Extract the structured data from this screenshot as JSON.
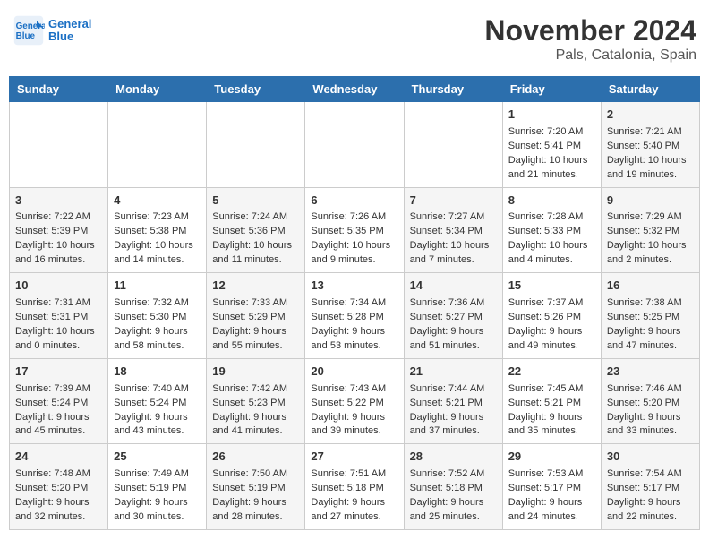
{
  "header": {
    "logo_line1": "General",
    "logo_line2": "Blue",
    "month": "November 2024",
    "location": "Pals, Catalonia, Spain"
  },
  "days_of_week": [
    "Sunday",
    "Monday",
    "Tuesday",
    "Wednesday",
    "Thursday",
    "Friday",
    "Saturday"
  ],
  "weeks": [
    [
      {
        "day": "",
        "info": ""
      },
      {
        "day": "",
        "info": ""
      },
      {
        "day": "",
        "info": ""
      },
      {
        "day": "",
        "info": ""
      },
      {
        "day": "",
        "info": ""
      },
      {
        "day": "1",
        "info": "Sunrise: 7:20 AM\nSunset: 5:41 PM\nDaylight: 10 hours and 21 minutes."
      },
      {
        "day": "2",
        "info": "Sunrise: 7:21 AM\nSunset: 5:40 PM\nDaylight: 10 hours and 19 minutes."
      }
    ],
    [
      {
        "day": "3",
        "info": "Sunrise: 7:22 AM\nSunset: 5:39 PM\nDaylight: 10 hours and 16 minutes."
      },
      {
        "day": "4",
        "info": "Sunrise: 7:23 AM\nSunset: 5:38 PM\nDaylight: 10 hours and 14 minutes."
      },
      {
        "day": "5",
        "info": "Sunrise: 7:24 AM\nSunset: 5:36 PM\nDaylight: 10 hours and 11 minutes."
      },
      {
        "day": "6",
        "info": "Sunrise: 7:26 AM\nSunset: 5:35 PM\nDaylight: 10 hours and 9 minutes."
      },
      {
        "day": "7",
        "info": "Sunrise: 7:27 AM\nSunset: 5:34 PM\nDaylight: 10 hours and 7 minutes."
      },
      {
        "day": "8",
        "info": "Sunrise: 7:28 AM\nSunset: 5:33 PM\nDaylight: 10 hours and 4 minutes."
      },
      {
        "day": "9",
        "info": "Sunrise: 7:29 AM\nSunset: 5:32 PM\nDaylight: 10 hours and 2 minutes."
      }
    ],
    [
      {
        "day": "10",
        "info": "Sunrise: 7:31 AM\nSunset: 5:31 PM\nDaylight: 10 hours and 0 minutes."
      },
      {
        "day": "11",
        "info": "Sunrise: 7:32 AM\nSunset: 5:30 PM\nDaylight: 9 hours and 58 minutes."
      },
      {
        "day": "12",
        "info": "Sunrise: 7:33 AM\nSunset: 5:29 PM\nDaylight: 9 hours and 55 minutes."
      },
      {
        "day": "13",
        "info": "Sunrise: 7:34 AM\nSunset: 5:28 PM\nDaylight: 9 hours and 53 minutes."
      },
      {
        "day": "14",
        "info": "Sunrise: 7:36 AM\nSunset: 5:27 PM\nDaylight: 9 hours and 51 minutes."
      },
      {
        "day": "15",
        "info": "Sunrise: 7:37 AM\nSunset: 5:26 PM\nDaylight: 9 hours and 49 minutes."
      },
      {
        "day": "16",
        "info": "Sunrise: 7:38 AM\nSunset: 5:25 PM\nDaylight: 9 hours and 47 minutes."
      }
    ],
    [
      {
        "day": "17",
        "info": "Sunrise: 7:39 AM\nSunset: 5:24 PM\nDaylight: 9 hours and 45 minutes."
      },
      {
        "day": "18",
        "info": "Sunrise: 7:40 AM\nSunset: 5:24 PM\nDaylight: 9 hours and 43 minutes."
      },
      {
        "day": "19",
        "info": "Sunrise: 7:42 AM\nSunset: 5:23 PM\nDaylight: 9 hours and 41 minutes."
      },
      {
        "day": "20",
        "info": "Sunrise: 7:43 AM\nSunset: 5:22 PM\nDaylight: 9 hours and 39 minutes."
      },
      {
        "day": "21",
        "info": "Sunrise: 7:44 AM\nSunset: 5:21 PM\nDaylight: 9 hours and 37 minutes."
      },
      {
        "day": "22",
        "info": "Sunrise: 7:45 AM\nSunset: 5:21 PM\nDaylight: 9 hours and 35 minutes."
      },
      {
        "day": "23",
        "info": "Sunrise: 7:46 AM\nSunset: 5:20 PM\nDaylight: 9 hours and 33 minutes."
      }
    ],
    [
      {
        "day": "24",
        "info": "Sunrise: 7:48 AM\nSunset: 5:20 PM\nDaylight: 9 hours and 32 minutes."
      },
      {
        "day": "25",
        "info": "Sunrise: 7:49 AM\nSunset: 5:19 PM\nDaylight: 9 hours and 30 minutes."
      },
      {
        "day": "26",
        "info": "Sunrise: 7:50 AM\nSunset: 5:19 PM\nDaylight: 9 hours and 28 minutes."
      },
      {
        "day": "27",
        "info": "Sunrise: 7:51 AM\nSunset: 5:18 PM\nDaylight: 9 hours and 27 minutes."
      },
      {
        "day": "28",
        "info": "Sunrise: 7:52 AM\nSunset: 5:18 PM\nDaylight: 9 hours and 25 minutes."
      },
      {
        "day": "29",
        "info": "Sunrise: 7:53 AM\nSunset: 5:17 PM\nDaylight: 9 hours and 24 minutes."
      },
      {
        "day": "30",
        "info": "Sunrise: 7:54 AM\nSunset: 5:17 PM\nDaylight: 9 hours and 22 minutes."
      }
    ]
  ]
}
